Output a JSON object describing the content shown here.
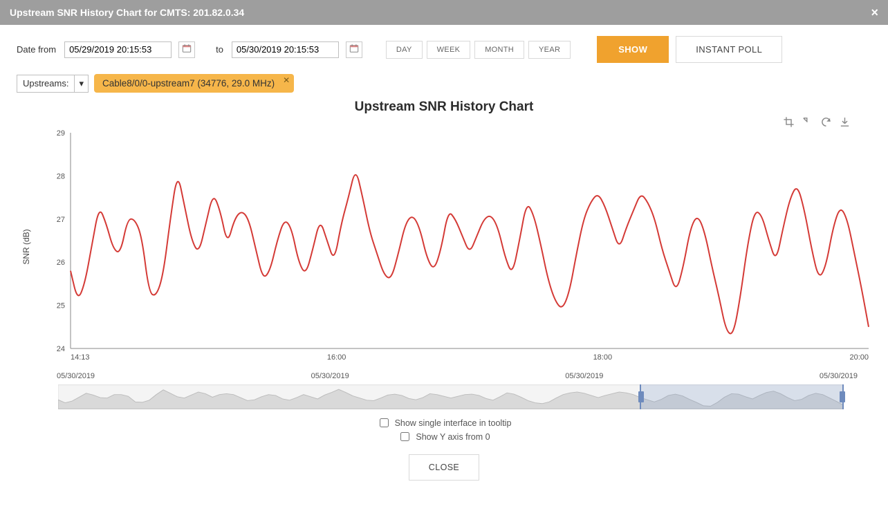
{
  "header": {
    "title": "Upstream SNR History Chart for CMTS: 201.82.0.34"
  },
  "filters": {
    "date_from_label": "Date from",
    "date_to_label": "to",
    "date_from": "05/29/2019 20:15:53",
    "date_to": "05/30/2019 20:15:53",
    "range_buttons": [
      "DAY",
      "WEEK",
      "MONTH",
      "YEAR"
    ],
    "show_label": "SHOW",
    "instant_poll_label": "INSTANT POLL"
  },
  "upstreams": {
    "label": "Upstreams:",
    "selected_chip": "Cable8/0/0-upstream7 (34776, 29.0 MHz)"
  },
  "chart_data": {
    "type": "line",
    "title": "Upstream SNR History Chart",
    "ylabel": "SNR (dB)",
    "ylim": [
      24,
      29
    ],
    "y_ticks": [
      24,
      25,
      26,
      27,
      28,
      29
    ],
    "x_ticks": [
      "14:13",
      "16:00",
      "18:00",
      "20:00"
    ],
    "x_date": "05/30/2019",
    "series": [
      {
        "name": "Cable8/0/0-upstream7",
        "color": "#d43a36",
        "values": [
          25.8,
          25.1,
          25.5,
          26.4,
          27.3,
          26.9,
          26.3,
          26.2,
          27.0,
          27.0,
          26.6,
          25.3,
          25.2,
          25.7,
          27.0,
          28.1,
          27.3,
          26.5,
          26.2,
          26.9,
          27.6,
          27.2,
          26.4,
          27.0,
          27.2,
          27.0,
          26.3,
          25.6,
          25.8,
          26.5,
          27.0,
          26.8,
          26.0,
          25.7,
          26.3,
          27.0,
          26.5,
          26.0,
          26.9,
          27.5,
          28.2,
          27.5,
          26.7,
          26.2,
          25.7,
          25.6,
          26.2,
          26.9,
          27.1,
          26.8,
          26.1,
          25.8,
          26.3,
          27.2,
          27.0,
          26.6,
          26.2,
          26.6,
          27.0,
          27.1,
          26.8,
          26.1,
          25.7,
          26.5,
          27.4,
          27.1,
          26.4,
          25.6,
          25.1,
          24.9,
          25.3,
          26.2,
          27.0,
          27.4,
          27.6,
          27.3,
          26.8,
          26.3,
          26.8,
          27.2,
          27.6,
          27.4,
          27.0,
          26.3,
          25.8,
          25.3,
          25.9,
          26.8,
          27.1,
          26.7,
          25.9,
          25.2,
          24.4,
          24.3,
          25.2,
          26.4,
          27.2,
          27.1,
          26.5,
          26.0,
          26.8,
          27.5,
          27.8,
          27.2,
          26.3,
          25.6,
          25.9,
          26.8,
          27.3,
          27.0,
          26.2,
          25.4,
          24.5
        ]
      }
    ]
  },
  "options": {
    "single_interface_label": "Show single interface in tooltip",
    "yaxis_zero_label": "Show Y axis from 0"
  },
  "footer": {
    "close_label": "CLOSE"
  }
}
